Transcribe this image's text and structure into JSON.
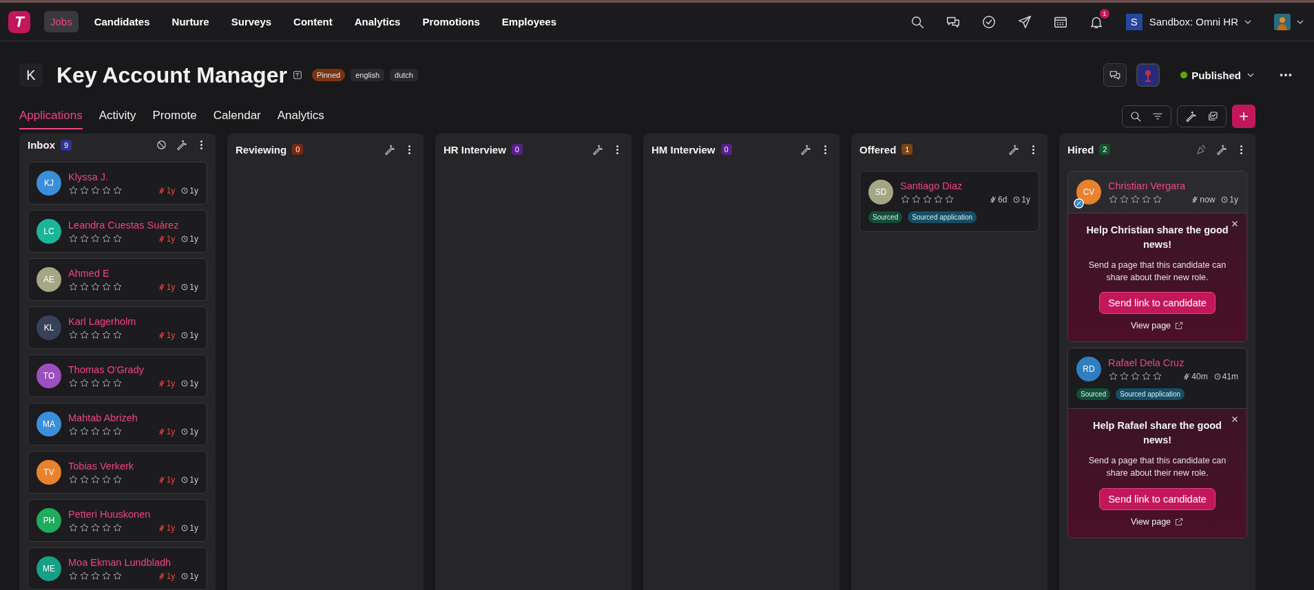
{
  "nav": {
    "logo": "T",
    "items": [
      {
        "label": "Jobs",
        "selected": true
      },
      {
        "label": "Candidates",
        "selected": false
      },
      {
        "label": "Nurture",
        "selected": false
      },
      {
        "label": "Surveys",
        "selected": false
      },
      {
        "label": "Content",
        "selected": false
      },
      {
        "label": "Analytics",
        "selected": false
      },
      {
        "label": "Promotions",
        "selected": false
      },
      {
        "label": "Employees",
        "selected": false
      }
    ],
    "notifications": "1",
    "workspace": {
      "initial": "S",
      "name": "Sandbox: Omni HR"
    }
  },
  "job": {
    "initial": "K",
    "title": "Key Account Manager",
    "tags": [
      {
        "label": "Pinned",
        "kind": "pinned"
      },
      {
        "label": "english",
        "kind": "plain"
      },
      {
        "label": "dutch",
        "kind": "plain"
      }
    ],
    "status": "Published",
    "tabs": [
      {
        "label": "Applications",
        "selected": true
      },
      {
        "label": "Activity",
        "selected": false
      },
      {
        "label": "Promote",
        "selected": false
      },
      {
        "label": "Calendar",
        "selected": false
      },
      {
        "label": "Analytics",
        "selected": false
      }
    ]
  },
  "columns": [
    {
      "title": "Inbox",
      "count": "9",
      "color": "#2d3490",
      "kind": "inbox",
      "cards": [
        {
          "initials": "KJ",
          "color": "#3b8fd9",
          "name": "Klyssa J.",
          "stars": 0,
          "activity": "1y",
          "overdue": true,
          "age": "1y"
        },
        {
          "initials": "LC",
          "color": "#1bb59a",
          "name": "Leandra Cuestas Suárez",
          "stars": 0,
          "activity": "1y",
          "overdue": true,
          "age": "1y"
        },
        {
          "initials": "AE",
          "color": "#a4a685",
          "name": "Ahmed E",
          "stars": 0,
          "activity": "1y",
          "overdue": true,
          "age": "1y"
        },
        {
          "initials": "KL",
          "color": "#374258",
          "name": "Karl Lagerholm",
          "stars": 0,
          "activity": "1y",
          "overdue": true,
          "age": "1y"
        },
        {
          "initials": "TO",
          "color": "#9c4fbf",
          "name": "Thomas O'Grady",
          "stars": 0,
          "activity": "1y",
          "overdue": true,
          "age": "1y"
        },
        {
          "initials": "MA",
          "color": "#3b8fd9",
          "name": "Mahtab Abrizeh",
          "stars": 0,
          "activity": "1y",
          "overdue": true,
          "age": "1y"
        },
        {
          "initials": "TV",
          "color": "#e8822f",
          "name": "Tobias Verkerk",
          "stars": 0,
          "activity": "1y",
          "overdue": true,
          "age": "1y"
        },
        {
          "initials": "PH",
          "color": "#1faa5c",
          "name": "Petteri Huuskonen",
          "stars": 0,
          "activity": "1y",
          "overdue": true,
          "age": "1y"
        },
        {
          "initials": "ME",
          "color": "#17a085",
          "name": "Moa Ekman Lundbladh",
          "stars": 0,
          "activity": "1y",
          "overdue": true,
          "age": "1y"
        }
      ]
    },
    {
      "title": "Reviewing",
      "count": "0",
      "color": "#7a2812",
      "kind": "stage"
    },
    {
      "title": "HR Interview",
      "count": "0",
      "color": "#5a1f8c",
      "kind": "stage"
    },
    {
      "title": "HM Interview",
      "count": "0",
      "color": "#5a1f8c",
      "kind": "stage"
    },
    {
      "title": "Offered",
      "count": "1",
      "color": "#7a4514",
      "kind": "stage",
      "cards": [
        {
          "initials": "SD",
          "color": "#a4a685",
          "name": "Santiago Diaz",
          "stars": 0,
          "activity": "6d",
          "overdue": false,
          "age": "1y",
          "tags": [
            {
              "label": "Sourced",
              "kind": "sourced"
            },
            {
              "label": "Sourced application",
              "kind": "application"
            }
          ]
        }
      ]
    },
    {
      "title": "Hired",
      "count": "2",
      "color": "#14532d",
      "kind": "hired",
      "cards": [
        {
          "initials": "CV",
          "color": "#e8822f",
          "name": "Christian Vergara",
          "stars": 0,
          "activity": "now",
          "overdue": false,
          "age": "1y",
          "badge": true,
          "promo": {
            "title": "Help Christian share the good news!",
            "body": "Send a page that this candidate can share about their new role.",
            "button": "Send link to candidate",
            "link": "View page"
          }
        },
        {
          "initials": "RD",
          "color": "#2f7fc0",
          "name": "Rafael Dela Cruz",
          "stars": 0,
          "activity": "40m",
          "overdue": false,
          "age": "41m",
          "tags": [
            {
              "label": "Sourced",
              "kind": "sourced"
            },
            {
              "label": "Sourced application",
              "kind": "application"
            }
          ],
          "promo": {
            "title": "Help Rafael share the good news!",
            "body": "Send a page that this candidate can share about their new role.",
            "button": "Send link to candidate",
            "link": "View page"
          }
        }
      ]
    }
  ]
}
